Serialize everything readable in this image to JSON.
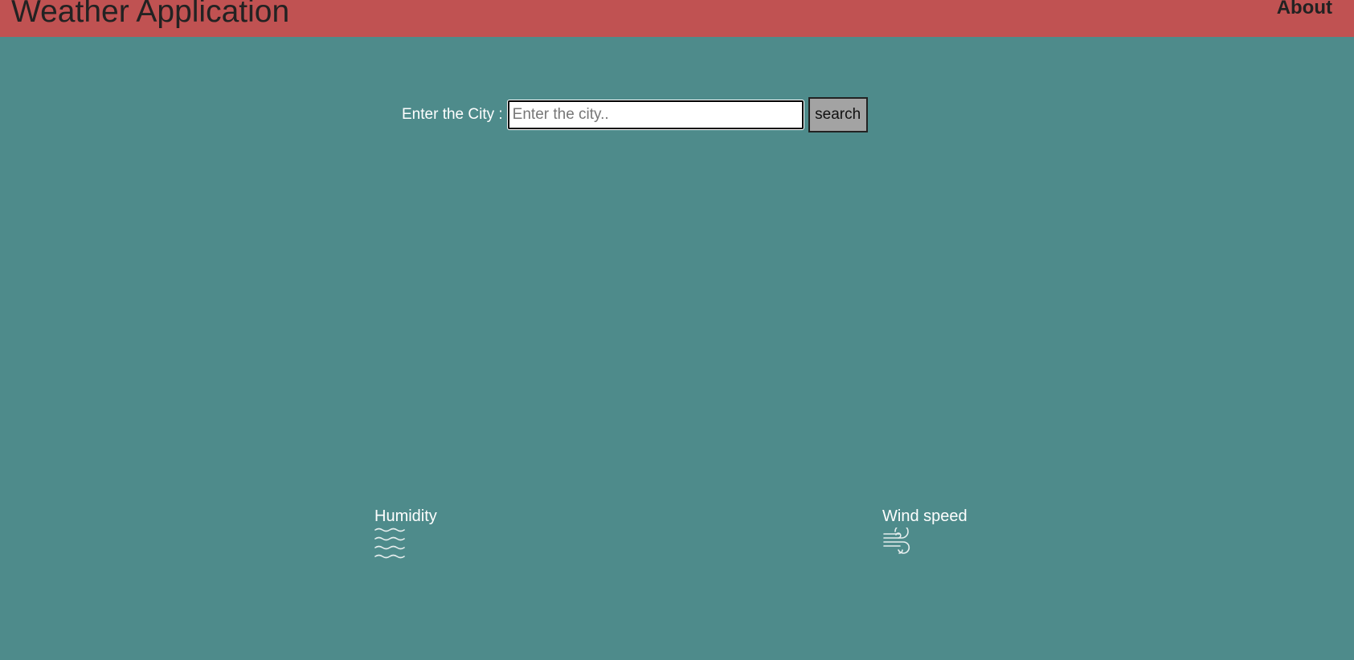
{
  "header": {
    "title": "Weather Application",
    "about_label": "About",
    "background_color": "#c05252"
  },
  "search": {
    "label": "Enter the City :",
    "placeholder": "Enter the city..",
    "value": "",
    "button_label": "search"
  },
  "metrics": {
    "humidity": {
      "label": "Humidity",
      "icon": "water-waves-icon"
    },
    "wind": {
      "label": "Wind speed",
      "icon": "wind-icon"
    }
  },
  "colors": {
    "page_background": "#4e8b8b",
    "text_light": "#ffffff",
    "text_dark": "#222222",
    "button_background": "#a3a3a3"
  }
}
